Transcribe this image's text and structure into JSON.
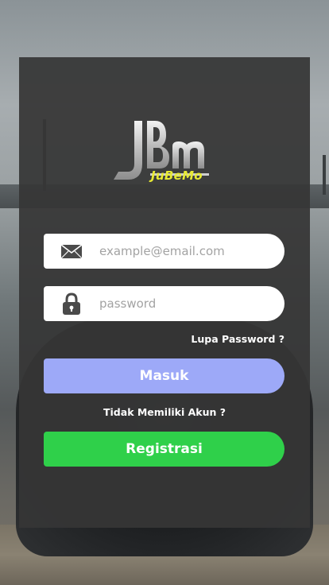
{
  "brand": {
    "logo_text": "JuBeMo",
    "logo_color": "#e7ea33"
  },
  "login_form": {
    "email": {
      "icon": "envelope-icon",
      "placeholder": "example@email.com",
      "value": ""
    },
    "password": {
      "icon": "lock-icon",
      "placeholder": "password",
      "value": ""
    },
    "forgot_password_label": "Lupa Password ?",
    "login_button_label": "Masuk",
    "login_button_color": "#9da9f8"
  },
  "register": {
    "prompt": "Tidak Memiliki Akun ?",
    "button_label": "Registrasi",
    "button_color": "#2fd04a"
  }
}
